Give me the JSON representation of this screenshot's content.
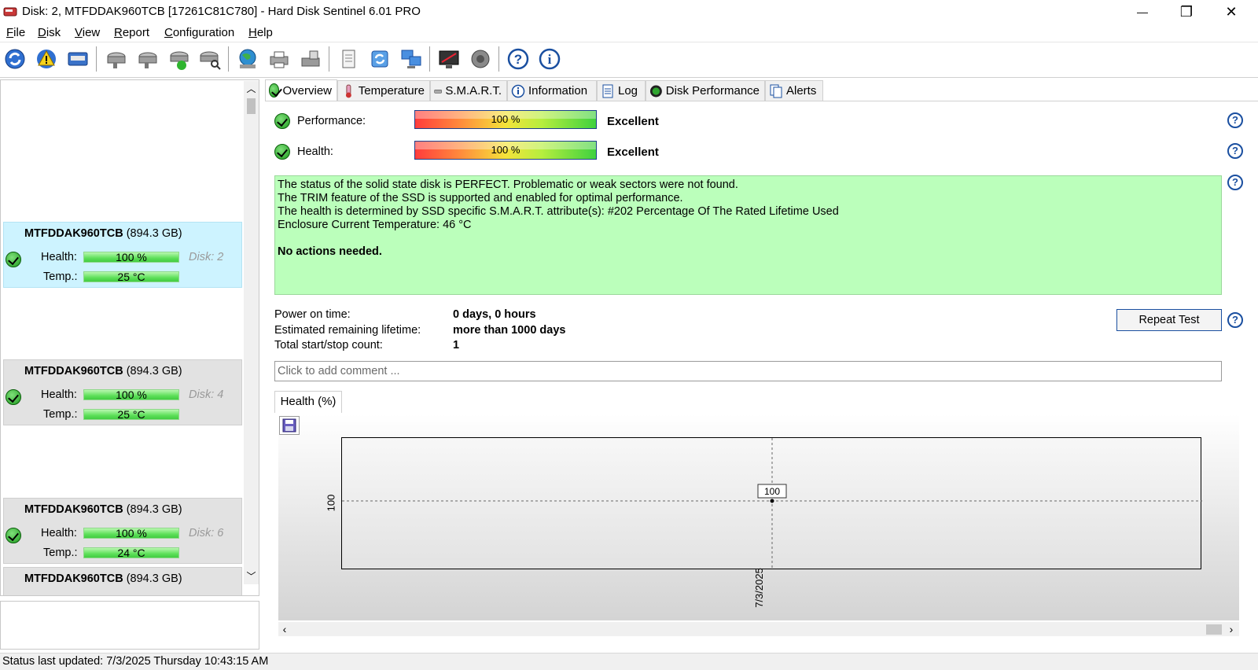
{
  "window": {
    "title": "Disk: 2, MTFDDAK960TCB [17261C81C780]  -  Hard Disk Sentinel 6.01 PRO",
    "minimize": "—",
    "maximize": "❐",
    "close": "✕"
  },
  "menu": [
    "File",
    "Disk",
    "View",
    "Report",
    "Configuration",
    "Help"
  ],
  "toolbar": {
    "icons": [
      "refresh-icon",
      "alert-icon",
      "disk-drive-icon",
      "disk-test-icon",
      "disk-test-2-icon",
      "disk-check-icon",
      "disk-search-icon",
      "globe-icon",
      "printer-icon",
      "scanner-icon",
      "report-icon",
      "sync-icon",
      "network-icon",
      "monitor-icon",
      "sound-icon",
      "help-icon",
      "info-icon"
    ]
  },
  "disks": [
    {
      "model": "MTFDDAK960TCB",
      "size": "(894.3 GB)",
      "health_label": "Health:",
      "health": "100 %",
      "disk": "Disk: 2",
      "temp_label": "Temp.:",
      "temp": "25 °C",
      "selected": true
    },
    {
      "model": "MTFDDAK960TCB",
      "size": "(894.3 GB)",
      "health_label": "Health:",
      "health": "100 %",
      "disk": "Disk: 4",
      "temp_label": "Temp.:",
      "temp": "25 °C",
      "selected": false
    },
    {
      "model": "MTFDDAK960TCB",
      "size": "(894.3 GB)",
      "health_label": "Health:",
      "health": "100 %",
      "disk": "Disk: 6",
      "temp_label": "Temp.:",
      "temp": "24 °C",
      "selected": false
    },
    {
      "model": "MTFDDAK960TCB",
      "size": "(894.3 GB)"
    }
  ],
  "tabs": [
    "Overview",
    "Temperature",
    "S.M.A.R.T.",
    "Information",
    "Log",
    "Disk Performance",
    "Alerts"
  ],
  "overview": {
    "performance_label": "Performance:",
    "performance_value": "100 %",
    "performance_rating": "Excellent",
    "health_label": "Health:",
    "health_value": "100 %",
    "health_rating": "Excellent",
    "status_lines": [
      "The status of the solid state disk is PERFECT. Problematic or weak sectors were not found.",
      "The TRIM feature of the SSD is supported and enabled for optimal performance.",
      "The health is determined by SSD specific S.M.A.R.T. attribute(s):  #202 Percentage Of The Rated Lifetime Used",
      "Enclosure Current Temperature: 46 °C"
    ],
    "status_action": "No actions needed.",
    "power_on_label": "Power on time:",
    "power_on_value": "0 days, 0 hours",
    "lifetime_label": "Estimated remaining lifetime:",
    "lifetime_value": "more than 1000 days",
    "startstop_label": "Total start/stop count:",
    "startstop_value": "1",
    "repeat_button": "Repeat Test",
    "comment_placeholder": "Click to add comment ..."
  },
  "chart_tab": "Health (%)",
  "chart_data": {
    "type": "line",
    "x": [
      "7/3/2025"
    ],
    "values": [
      100
    ],
    "y_tick": "100",
    "point_label": "100",
    "grid": true
  },
  "status_bar": "Status last updated: 7/3/2025 Thursday 10:43:15 AM",
  "colors": {
    "status_bg": "#bbffbb",
    "selected_disk": "#cdf3ff",
    "help_blue": "#1a4fa0"
  }
}
